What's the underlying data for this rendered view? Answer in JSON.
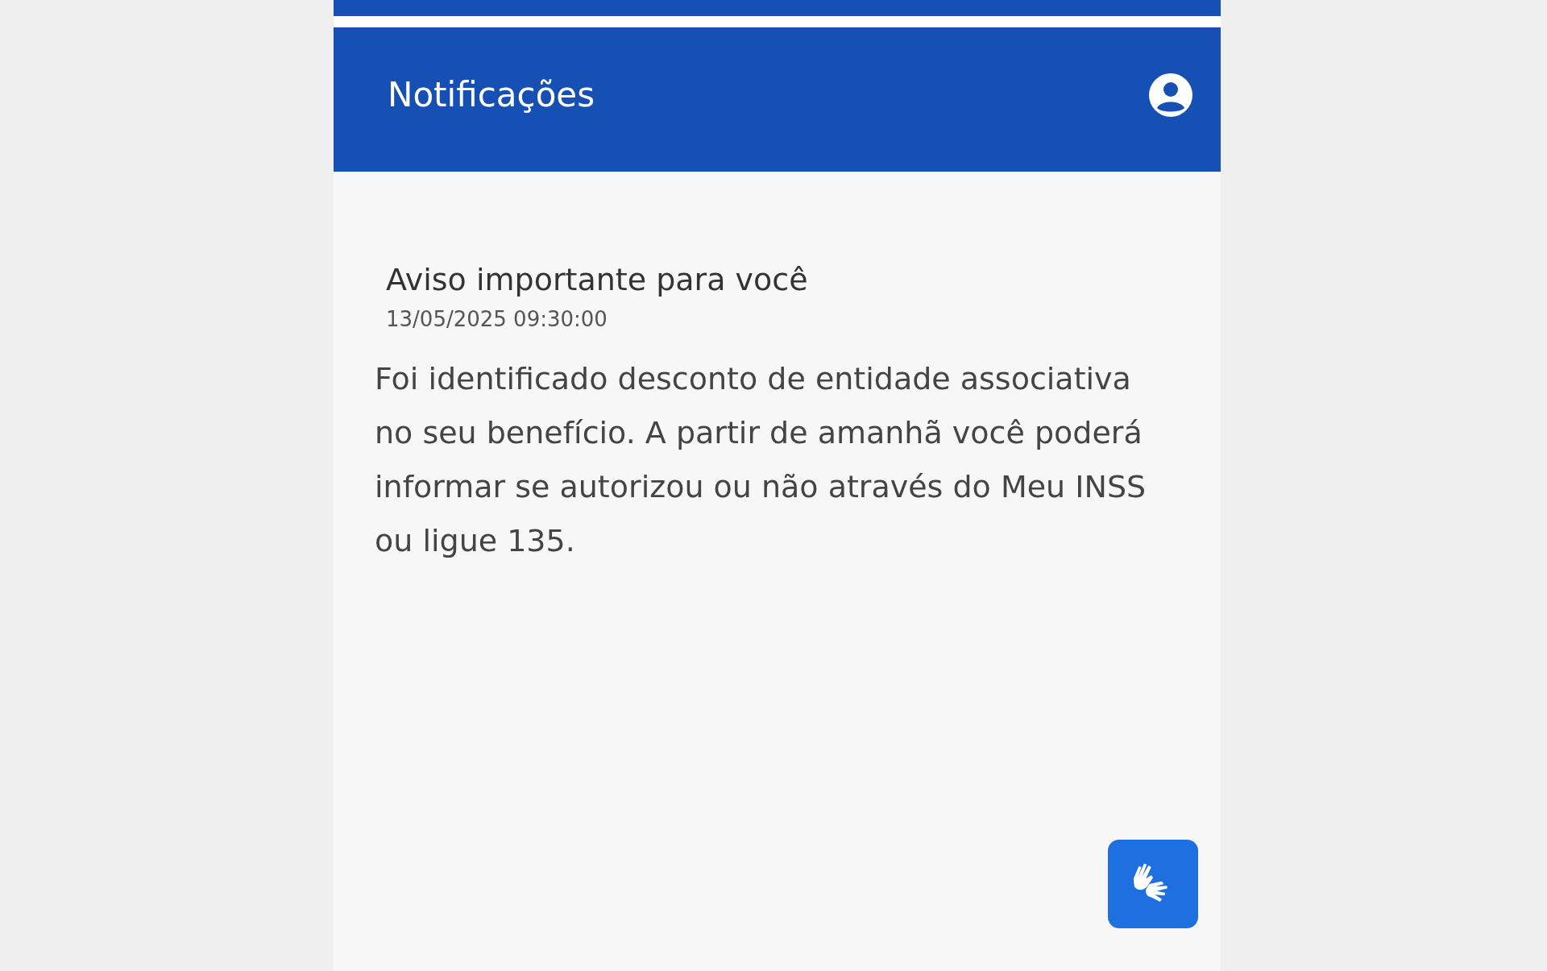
{
  "header": {
    "title": "Notificações"
  },
  "notifications": [
    {
      "title": "Aviso importante para você",
      "date": "13/05/2025 09:30:00",
      "body": "Foi identificado desconto de entidade associativa no seu benefício. A partir de amanhã você poderá informar se autorizou ou não através do Meu INSS ou ligue 135."
    }
  ]
}
